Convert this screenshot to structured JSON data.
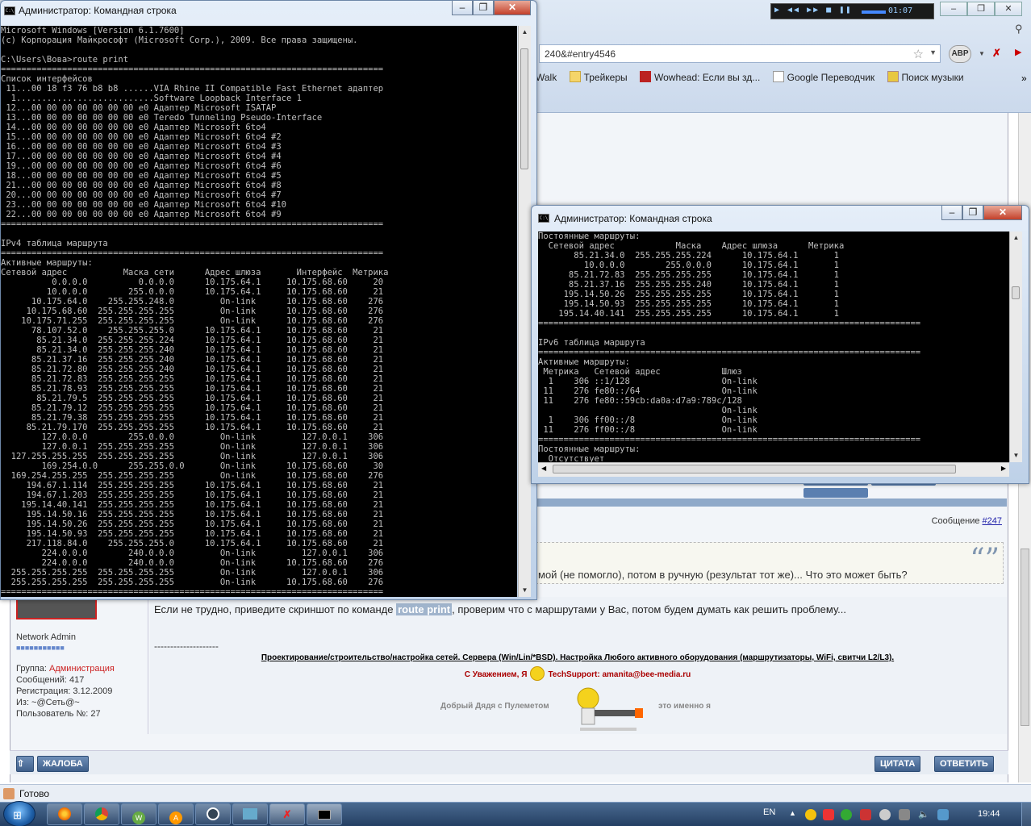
{
  "browser": {
    "media_time": "01:07",
    "address": "240&#entry4546",
    "bookmarks": [
      {
        "label": "Walk",
        "icon": "none"
      },
      {
        "label": "Трейкеры",
        "icon": "folder-icon"
      },
      {
        "label": "Wowhead: Если вы зд...",
        "icon": "wowhead-icon"
      },
      {
        "label": "Google Переводчик",
        "icon": "page-icon"
      },
      {
        "label": "Поиск музыки",
        "icon": "music-icon"
      }
    ],
    "abp_label": "ABP",
    "status_text": "Готово"
  },
  "forum": {
    "message_label": "Сообщение ",
    "message_link": "#247",
    "quote_text": "мой (не помогло), потом в ручную (результат тот же)... Что это может быть?",
    "post_text_before": "Если не трудно, приведите скриншот по команде ",
    "post_text_cmd": "route print",
    "post_text_after": ", проверим что с маршрутами у Вас, потом будем думать как решить проблему...",
    "separator": "--------------------",
    "sig_line1": "Проектирование/строительство/настройка сетей. Сервера (Win/Lin/*BSD). Настройка Любого активного оборудования (маршрутизаторы, WiFi, свитчи L2/L3).",
    "sig_line2_a": "С Уважением, Я",
    "sig_line2_b": "TechSupport: amanita@bee-media.ru",
    "sig_left": "Добрый Дядя с Пулеметом",
    "sig_right": "это именно я",
    "user": {
      "name": "Network Admin",
      "stars": "■■■■■■■■■■■",
      "group_label": "Группа: ",
      "group_value": "Администрация",
      "posts": "Сообщений: 417",
      "registered": "Регистрация: 3.12.2009",
      "from": "Из: ~@Сеть@~",
      "user_no": "Пользователь №: 27"
    },
    "buttons": {
      "complaint": "ЖАЛОБА",
      "quote": "ЦИТАТА",
      "reply": "ОТВЕТИТЬ"
    }
  },
  "console1": {
    "title": "Администратор: Командная строка",
    "text": "Microsoft Windows [Version 6.1.7600]\n(c) Корпорация Майкрософт (Microsoft Corp.), 2009. Все права защищены.\n\nC:\\Users\\Вова>route print\n===========================================================================\nСписок интерфейсов\n 11...00 18 f3 76 b8 b8 ......VIA Rhine II Compatible Fast Ethernet адаптер\n  1...........................Software Loopback Interface 1\n 12...00 00 00 00 00 00 00 e0 Адаптер Microsoft ISATAP\n 13...00 00 00 00 00 00 00 e0 Teredo Tunneling Pseudo-Interface\n 14...00 00 00 00 00 00 00 e0 Адаптер Microsoft 6to4\n 15...00 00 00 00 00 00 00 e0 Адаптер Microsoft 6to4 #2\n 16...00 00 00 00 00 00 00 e0 Адаптер Microsoft 6to4 #3\n 17...00 00 00 00 00 00 00 e0 Адаптер Microsoft 6to4 #4\n 19...00 00 00 00 00 00 00 e0 Адаптер Microsoft 6to4 #6\n 18...00 00 00 00 00 00 00 e0 Адаптер Microsoft 6to4 #5\n 21...00 00 00 00 00 00 00 e0 Адаптер Microsoft 6to4 #8\n 20...00 00 00 00 00 00 00 e0 Адаптер Microsoft 6to4 #7\n 23...00 00 00 00 00 00 00 e0 Адаптер Microsoft 6to4 #10\n 22...00 00 00 00 00 00 00 e0 Адаптер Microsoft 6to4 #9\n===========================================================================\n\nIPv4 таблица маршрута\n===========================================================================\nАктивные маршруты:\nСетевой адрес           Маска сети      Адрес шлюза       Интерфейс  Метрика\n          0.0.0.0          0.0.0.0      10.175.64.1     10.175.68.60     20\n         10.0.0.0        255.0.0.0      10.175.64.1     10.175.68.60     21\n      10.175.64.0    255.255.248.0         On-link      10.175.68.60    276\n     10.175.68.60  255.255.255.255         On-link      10.175.68.60    276\n    10.175.71.255  255.255.255.255         On-link      10.175.68.60    276\n      78.107.52.0    255.255.255.0      10.175.64.1     10.175.68.60     21\n       85.21.34.0  255.255.255.224      10.175.64.1     10.175.68.60     21\n       85.21.34.0  255.255.255.240      10.175.64.1     10.175.68.60     21\n      85.21.37.16  255.255.255.240      10.175.64.1     10.175.68.60     21\n      85.21.72.80  255.255.255.240      10.175.64.1     10.175.68.60     21\n      85.21.72.83  255.255.255.255      10.175.64.1     10.175.68.60     21\n      85.21.78.93  255.255.255.255      10.175.64.1     10.175.68.60     21\n       85.21.79.5  255.255.255.255      10.175.64.1     10.175.68.60     21\n      85.21.79.12  255.255.255.255      10.175.64.1     10.175.68.60     21\n      85.21.79.38  255.255.255.255      10.175.64.1     10.175.68.60     21\n     85.21.79.170  255.255.255.255      10.175.64.1     10.175.68.60     21\n        127.0.0.0        255.0.0.0         On-link         127.0.0.1    306\n        127.0.0.1  255.255.255.255         On-link         127.0.0.1    306\n  127.255.255.255  255.255.255.255         On-link         127.0.0.1    306\n        169.254.0.0      255.255.0.0       On-link      10.175.68.60     30\n  169.254.255.255  255.255.255.255         On-link      10.175.68.60    276\n     194.67.1.114  255.255.255.255      10.175.64.1     10.175.68.60     21\n     194.67.1.203  255.255.255.255      10.175.64.1     10.175.68.60     21\n    195.14.40.141  255.255.255.255      10.175.64.1     10.175.68.60     21\n     195.14.50.16  255.255.255.255      10.175.64.1     10.175.68.60     21\n     195.14.50.26  255.255.255.255      10.175.64.1     10.175.68.60     21\n     195.14.50.93  255.255.255.255      10.175.64.1     10.175.68.60     21\n     217.118.84.0    255.255.255.0      10.175.64.1     10.175.68.60     21\n        224.0.0.0        240.0.0.0         On-link         127.0.0.1    306\n        224.0.0.0        240.0.0.0         On-link      10.175.68.60    276\n  255.255.255.255  255.255.255.255         On-link         127.0.0.1    306\n  255.255.255.255  255.255.255.255         On-link      10.175.68.60    276\n==========================================================================="
  },
  "console2": {
    "title": "Администратор: Командная строка",
    "text": "Постоянные маршруты:\n  Сетевой адрес            Маска    Адрес шлюза      Метрика\n       85.21.34.0  255.255.255.224      10.175.64.1       1\n         10.0.0.0        255.0.0.0      10.175.64.1       1\n      85.21.72.83  255.255.255.255      10.175.64.1       1\n      85.21.37.16  255.255.255.240      10.175.64.1       1\n     195.14.50.26  255.255.255.255      10.175.64.1       1\n     195.14.50.93  255.255.255.255      10.175.64.1       1\n    195.14.40.141  255.255.255.255      10.175.64.1       1\n===========================================================================\n\nIPv6 таблица маршрута\n===========================================================================\nАктивные маршруты:\n Метрика   Сетевой адрес            Шлюз\n  1    306 ::1/128                  On-link\n 11    276 fe80::/64                On-link\n 11    276 fe80::59cb:da0a:d7a9:789c/128\n                                    On-link\n  1    306 ff00::/8                 On-link\n 11    276 ff00::/8                 On-link\n===========================================================================\nПостоянные маршруты:\n  Отсутствует"
  },
  "taskbar": {
    "lang": "EN",
    "clock": "19:44",
    "items": [
      "firefox-icon",
      "chrome-icon",
      "wow-icon",
      "aimp-icon",
      "network-icon",
      "adblock-icon",
      "cmd-icon"
    ]
  }
}
